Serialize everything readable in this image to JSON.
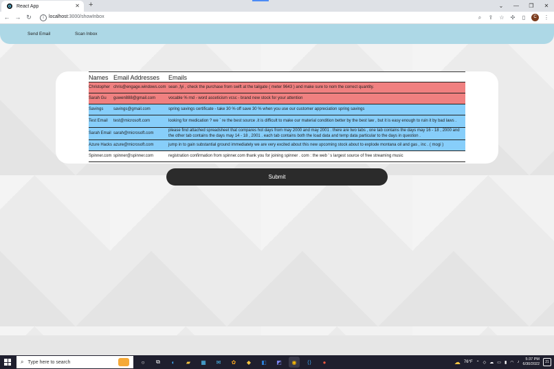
{
  "browser": {
    "tab_title": "React App",
    "url_host": "localhost",
    "url_path": ":3000/showInbox",
    "profile_initial": "C"
  },
  "nav": {
    "send_email": "Send Email",
    "scan_inbox": "Scan Inbox"
  },
  "table": {
    "headers": [
      "Names",
      "Email Addresses",
      "Emails"
    ],
    "rows": [
      {
        "name": "Christopher",
        "address": "chris@engage.windows.com",
        "email": "sean ,fyi , check the purchase from swift at the tailgate ( meter 9643 ) and make sure to nom the correct quantity.",
        "color": "red"
      },
      {
        "name": "Sarah Gu",
        "address": "guwen888@gmail.com",
        "email": "vocable % rnd - word asceticism vcsc - brand new stock for your attention",
        "color": "red"
      },
      {
        "name": "Savings",
        "address": "savings@gmail.com",
        "email": "spring savings certificate - take 30 % off save 30 % when you use our customer appreciation spring savings",
        "color": "blue"
      },
      {
        "name": "Test Email",
        "address": "test@microsoft.com",
        "email": "looking for medication ? we ` re the best source .it is difficult to make our material condition better by the best law , but it is easy enough to ruin it by bad laws .",
        "color": "blue"
      },
      {
        "name": "Sarah Email",
        "address": "sarah@microsoft.com",
        "email": "please find attached spreadsheet that compares hot days from may 2000 and may 2001 . there are two tabs , one tab contains the days may 16 - 18 , 2000 and the other tab contains the days may 14 - 18 , 2001 . each tab contains both the load data and temp data particular to the days in question .",
        "color": "blue"
      },
      {
        "name": "Azure Hacks",
        "address": "azure@microsoft.com",
        "email": "jump in to gain substantial ground immediately we are very excited about this new upcoming stock about to explode montana oil and gas , inc . ( mogi )",
        "color": "blue"
      },
      {
        "name": "Spinner.com",
        "address": "spinner@spinner.com",
        "email": "registration confirmation from spinner.com thank you for joining spinner . com : the web ' s largest source of free streaming music",
        "color": "white"
      }
    ]
  },
  "submit_label": "Submit",
  "taskbar": {
    "search_placeholder": "Type here to search",
    "weather": "76°F",
    "time": "5:37 PM",
    "date": "6/30/2022",
    "notification_count": "21"
  },
  "colors": {
    "navbar": "#add8e6",
    "row_red": "#f08080",
    "row_blue": "#87cefa",
    "submit": "#2b2b2b"
  }
}
